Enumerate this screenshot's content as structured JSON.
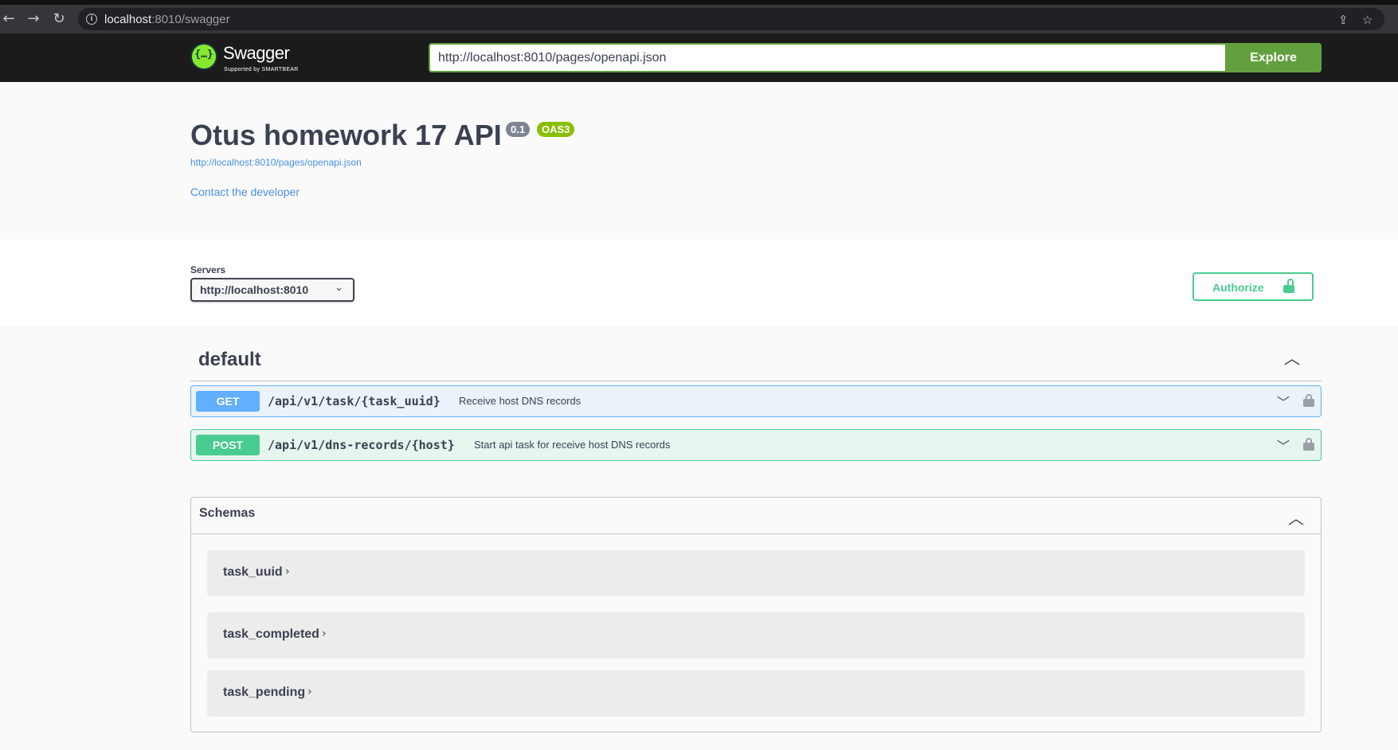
{
  "browser": {
    "url_host": "localhost",
    "url_rest": ":8010/swagger"
  },
  "topbar": {
    "logo_text": "Swagger",
    "logo_sub": "Supported by SMARTBEAR",
    "spec_url": "http://localhost:8010/pages/openapi.json",
    "explore_label": "Explore"
  },
  "info": {
    "title": "Otus homework 17 API",
    "version": "0.1",
    "oas_badge": "OAS3",
    "spec_link": "http://localhost:8010/pages/openapi.json",
    "contact": "Contact the developer"
  },
  "servers": {
    "label": "Servers",
    "selected": "http://localhost:8010"
  },
  "authorize_label": "Authorize",
  "tag": {
    "name": "default",
    "operations": [
      {
        "method": "GET",
        "path": "/api/v1/task/{task_uuid}",
        "summary": "Receive host DNS records"
      },
      {
        "method": "POST",
        "path": "/api/v1/dns-records/{host}",
        "summary": "Start api task for receive host DNS records"
      }
    ]
  },
  "schemas": {
    "title": "Schemas",
    "models": [
      "task_uuid",
      "task_completed",
      "task_pending"
    ]
  },
  "colors": {
    "get": "#61affe",
    "post": "#49cc90",
    "explore": "#62a03f",
    "topbar": "#1b1b1b"
  }
}
